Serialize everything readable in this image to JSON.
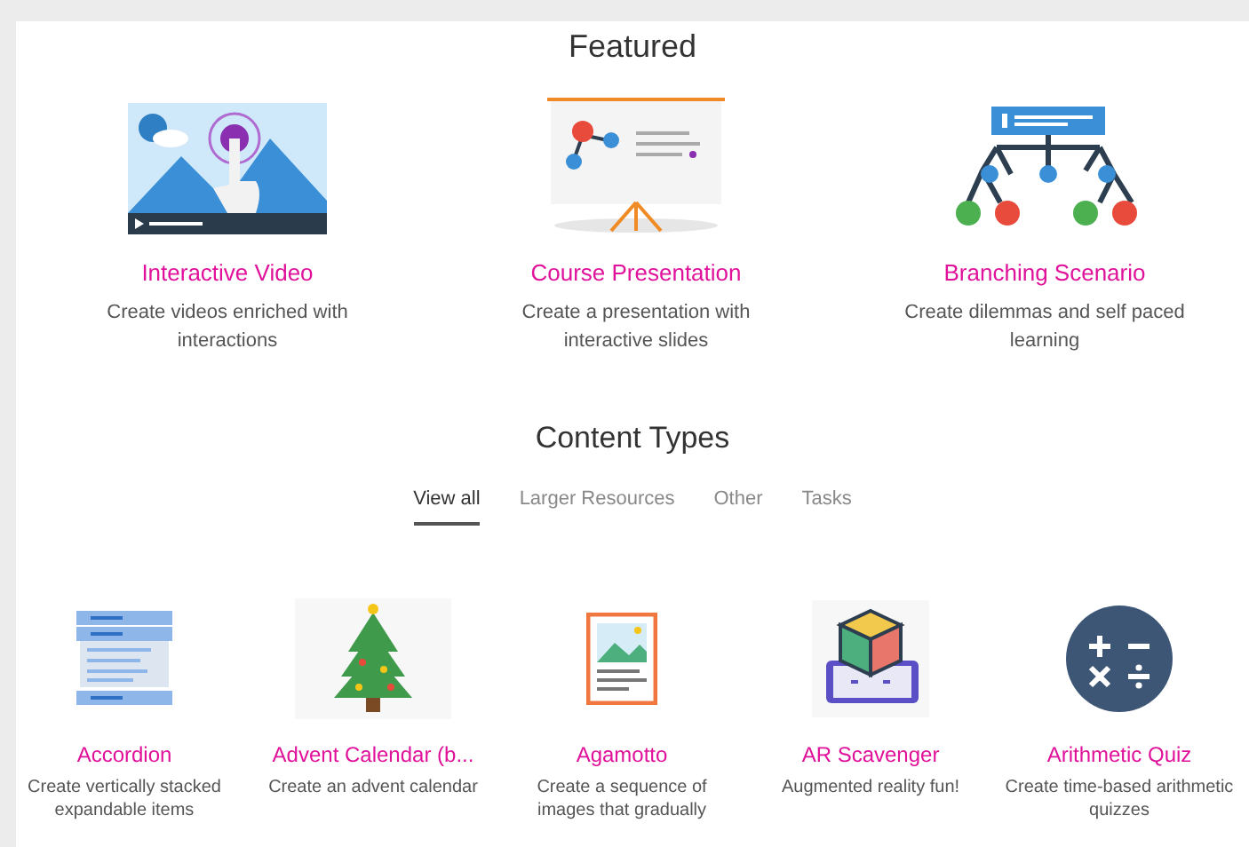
{
  "featured": {
    "title": "Featured",
    "items": [
      {
        "kind": "video",
        "title": "Interactive Video",
        "description": "Create videos enriched with interactions"
      },
      {
        "kind": "presentation",
        "title": "Course Presentation",
        "description": "Create a presentation with interactive slides"
      },
      {
        "kind": "branching",
        "title": "Branching Scenario",
        "description": "Create dilemmas and self paced learning"
      }
    ]
  },
  "content_types": {
    "title": "Content Types",
    "tabs": [
      {
        "label": "View all",
        "selected": true
      },
      {
        "label": "Larger Resources",
        "selected": false
      },
      {
        "label": "Other",
        "selected": false
      },
      {
        "label": "Tasks",
        "selected": false
      }
    ],
    "items": [
      {
        "kind": "accordion",
        "title": "Accordion",
        "description": "Create vertically stacked expandable items"
      },
      {
        "kind": "tree",
        "title": "Advent Calendar (b...",
        "description": "Create an advent calendar"
      },
      {
        "kind": "picture",
        "title": "Agamotto",
        "description": "Create a sequence of images that gradually"
      },
      {
        "kind": "cube",
        "title": "AR Scavenger",
        "description": "Augmented reality fun!"
      },
      {
        "kind": "math",
        "title": "Arithmetic Quiz",
        "description": "Create time-based arithmetic quizzes"
      }
    ]
  }
}
